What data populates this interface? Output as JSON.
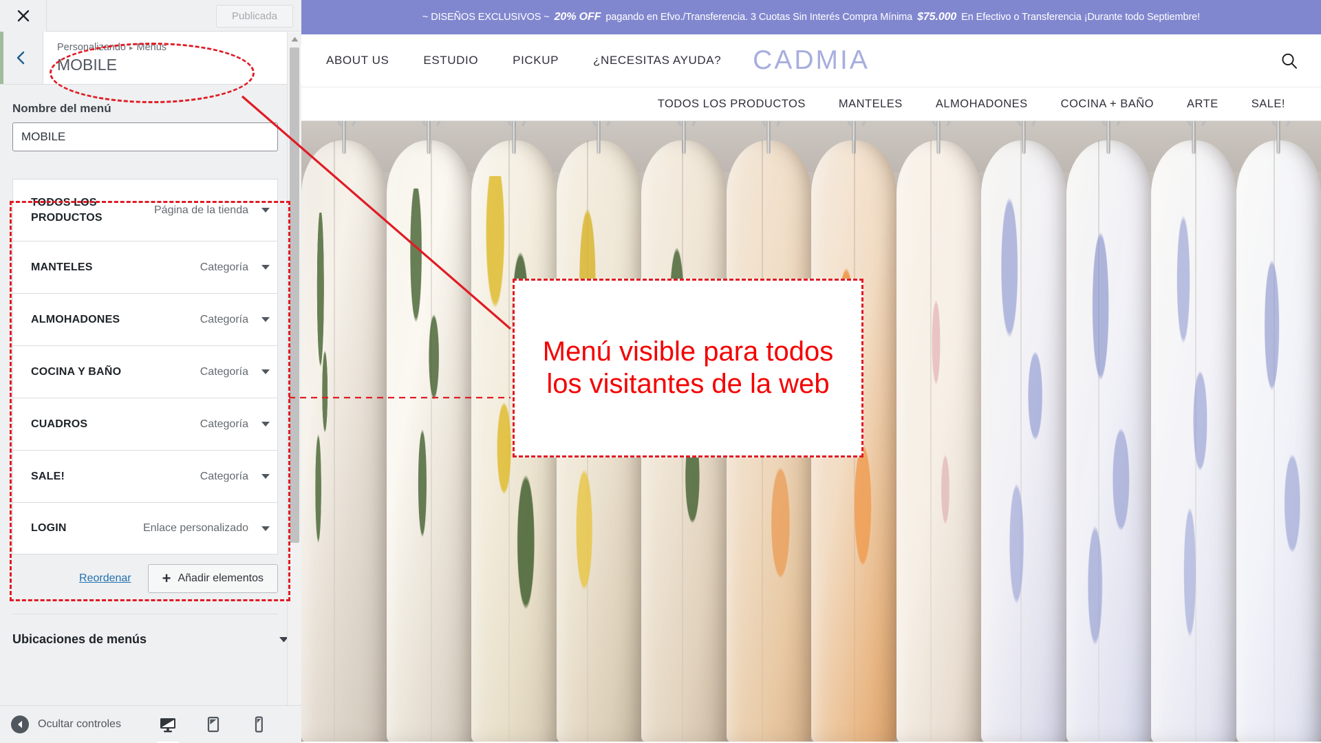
{
  "customizer": {
    "close_icon": "close-icon",
    "publish_button": "Publicada",
    "back_icon": "chevron-left-icon",
    "breadcrumb_root": "Personalizando",
    "breadcrumb_separator": "▸",
    "breadcrumb_current": "Menús",
    "panel_title": "MOBILE",
    "menu_name_label": "Nombre del menú",
    "menu_name_value": "MOBILE",
    "menu_items": [
      {
        "title": "TODOS LOS PRODUCTOS",
        "type": "Página de la tienda"
      },
      {
        "title": "MANTELES",
        "type": "Categoría"
      },
      {
        "title": "ALMOHADONES",
        "type": "Categoría"
      },
      {
        "title": "COCINA Y BAÑO",
        "type": "Categoría"
      },
      {
        "title": "CUADROS",
        "type": "Categoría"
      },
      {
        "title": "SALE!",
        "type": "Categoría"
      },
      {
        "title": "LOGIN",
        "type": "Enlace personalizado"
      }
    ],
    "reorder_label": "Reordenar",
    "add_items_label": "Añadir elementos",
    "add_items_icon": "plus-icon",
    "menu_locations_label": "Ubicaciones de menús",
    "footer": {
      "collapse_label": "Ocultar controles",
      "collapse_icon": "chevron-left-circle-icon",
      "devices": [
        {
          "name": "desktop-icon",
          "active": true
        },
        {
          "name": "tablet-icon",
          "active": false
        },
        {
          "name": "mobile-icon",
          "active": false
        }
      ]
    },
    "accent_color": "#9fbc9b"
  },
  "site": {
    "promo_bar": {
      "prefix": "~ DISEÑOS EXCLUSIVOS ~",
      "discount": "20% OFF",
      "mid": "pagando en Efvo./Transferencia. 3 Cuotas Sin Interés Compra Mínima",
      "amount": "$75.000",
      "suffix": "En Efectivo o Transferencia ¡Durante todo Septiembre!",
      "background": "#8187cf"
    },
    "brand": "CADMIA",
    "brand_color": "#a7aede",
    "search_icon": "search-icon",
    "nav_primary": [
      "ABOUT US",
      "ESTUDIO",
      "PICKUP",
      "¿NECESITAS AYUDA?"
    ],
    "nav_secondary": [
      "TODOS LOS PRODUCTOS",
      "MANTELES",
      "ALMOHADONES",
      "COCINA + BAÑO",
      "ARTE",
      "SALE!"
    ]
  },
  "annotations": {
    "callout_text": "Menú visible para todos los visitantes de la web",
    "color": "#e01b24"
  }
}
